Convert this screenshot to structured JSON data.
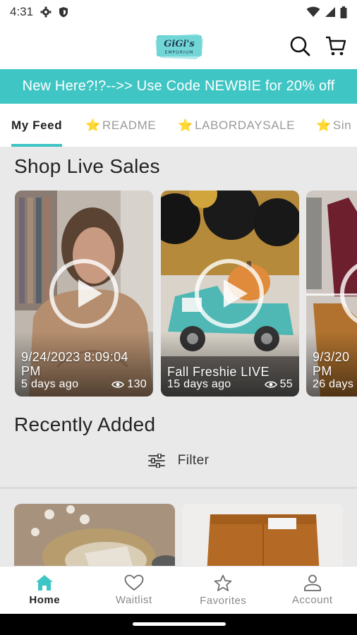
{
  "status_bar": {
    "time": "4:31"
  },
  "header": {
    "logo_text": "GiGi's",
    "logo_subtext": "EMPORIUM"
  },
  "promo": {
    "text": "New Here?!?-->> Use Code NEWBIE for 20% off"
  },
  "tabs": [
    {
      "label": "My Feed",
      "active": true
    },
    {
      "label": "README",
      "star": "⭐"
    },
    {
      "label": "LABORDAYSALE",
      "star": "⭐"
    },
    {
      "label": "Sin",
      "star": "⭐"
    }
  ],
  "live_sales": {
    "title": "Shop Live Sales",
    "cards": [
      {
        "title": "9/24/2023 8:09:04 PM",
        "age": "5 days ago",
        "views": "130"
      },
      {
        "title": "Fall Freshie LIVE",
        "age": "15 days ago",
        "views": "55"
      },
      {
        "title": "9/3/20 PM",
        "age": "26 days"
      }
    ]
  },
  "recently_added": {
    "title": "Recently Added",
    "filter_label": "Filter"
  },
  "bottom_nav": [
    {
      "label": "Home",
      "active": true
    },
    {
      "label": "Waitlist"
    },
    {
      "label": "Favorites"
    },
    {
      "label": "Account"
    }
  ],
  "colors": {
    "accent": "#3fc5c4",
    "star": "#f3c22c"
  }
}
